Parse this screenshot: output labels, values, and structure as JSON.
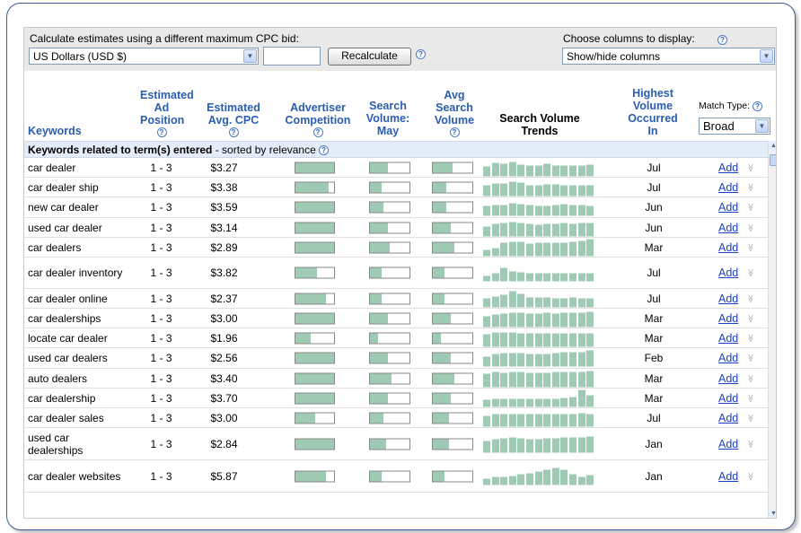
{
  "controls": {
    "cpc_label": "Calculate estimates using a different maximum CPC bid:",
    "currency_value": "US Dollars (USD $)",
    "bid_value": "",
    "recalculate_label": "Recalculate",
    "columns_label": "Choose columns to display:",
    "columns_value": "Show/hide columns",
    "match_type_label": "Match Type:",
    "match_type_value": "Broad"
  },
  "headers": {
    "keywords": "Keywords",
    "ad_position": "Estimated Ad Position",
    "avg_cpc": "Estimated Avg. CPC",
    "competition": "Advertiser Competition",
    "search_volume": "Search Volume: May",
    "avg_search_volume": "Avg Search Volume",
    "trends": "Search Volume Trends",
    "highest_volume": "Highest Volume Occurred In"
  },
  "section": {
    "title": "Keywords related to term(s) entered",
    "subtitle": " - sorted by relevance "
  },
  "add_label": "Add",
  "colors": {
    "bar_fill": "#9fcbb5",
    "header_link": "#2a5db0",
    "link": "#1a3fc4"
  },
  "rows": [
    {
      "keyword": "car dealer",
      "position": "1 - 3",
      "cpc": "$3.27",
      "competition": 1.0,
      "volume_may": 0.45,
      "avg_volume": 0.5,
      "trend": [
        0.55,
        0.75,
        0.7,
        0.8,
        0.65,
        0.6,
        0.62,
        0.7,
        0.6,
        0.62,
        0.6,
        0.62,
        0.65
      ],
      "highest": "Jul"
    },
    {
      "keyword": "car dealer ship",
      "position": "1 - 3",
      "cpc": "$3.38",
      "competition": 0.85,
      "volume_may": 0.3,
      "avg_volume": 0.35,
      "trend": [
        0.6,
        0.7,
        0.7,
        0.8,
        0.75,
        0.6,
        0.6,
        0.65,
        0.65,
        0.6,
        0.6,
        0.6,
        0.6
      ],
      "highest": "Jul"
    },
    {
      "keyword": "new car dealer",
      "position": "1 - 3",
      "cpc": "$3.59",
      "competition": 1.0,
      "volume_may": 0.35,
      "avg_volume": 0.35,
      "trend": [
        0.6,
        0.65,
        0.65,
        0.75,
        0.7,
        0.65,
        0.6,
        0.6,
        0.65,
        0.7,
        0.65,
        0.65,
        0.6
      ],
      "highest": "Jun"
    },
    {
      "keyword": "used car dealer",
      "position": "1 - 3",
      "cpc": "$3.14",
      "competition": 1.0,
      "volume_may": 0.45,
      "avg_volume": 0.45,
      "trend": [
        0.55,
        0.7,
        0.75,
        0.8,
        0.75,
        0.7,
        0.65,
        0.7,
        0.7,
        0.75,
        0.7,
        0.75,
        0.75
      ],
      "highest": "Jun"
    },
    {
      "keyword": "car dealers",
      "position": "1 - 3",
      "cpc": "$2.89",
      "competition": 1.0,
      "volume_may": 0.5,
      "avg_volume": 0.55,
      "trend": [
        0.35,
        0.45,
        0.75,
        0.8,
        0.8,
        0.7,
        0.75,
        0.75,
        0.75,
        0.75,
        0.8,
        0.85,
        1.0
      ],
      "highest": "Mar"
    },
    {
      "keyword": "car dealer inventory",
      "position": "1 - 3",
      "cpc": "$3.82",
      "competition": 0.55,
      "volume_may": 0.3,
      "avg_volume": 0.3,
      "trend": [
        0.3,
        0.5,
        0.8,
        0.6,
        0.55,
        0.5,
        0.5,
        0.5,
        0.5,
        0.5,
        0.5,
        0.5,
        0.5
      ],
      "highest": "Jul"
    },
    {
      "keyword": "car dealer online",
      "position": "1 - 3",
      "cpc": "$2.37",
      "competition": 0.8,
      "volume_may": 0.3,
      "avg_volume": 0.3,
      "trend": [
        0.5,
        0.6,
        0.7,
        0.9,
        0.75,
        0.55,
        0.55,
        0.55,
        0.5,
        0.5,
        0.55,
        0.5,
        0.5
      ],
      "highest": "Jul"
    },
    {
      "keyword": "car dealerships",
      "position": "1 - 3",
      "cpc": "$3.00",
      "competition": 1.0,
      "volume_may": 0.45,
      "avg_volume": 0.45,
      "trend": [
        0.6,
        0.7,
        0.75,
        0.8,
        0.8,
        0.75,
        0.75,
        0.8,
        0.75,
        0.8,
        0.8,
        0.8,
        0.85
      ],
      "highest": "Mar"
    },
    {
      "keyword": "locate car dealer",
      "position": "1 - 3",
      "cpc": "$1.96",
      "competition": 0.4,
      "volume_may": 0.2,
      "avg_volume": 0.2,
      "trend": [
        0.7,
        0.8,
        0.8,
        0.8,
        0.75,
        0.75,
        0.75,
        0.75,
        0.75,
        0.75,
        0.75,
        0.75,
        0.75
      ],
      "highest": "Mar"
    },
    {
      "keyword": "used car dealers",
      "position": "1 - 3",
      "cpc": "$2.56",
      "competition": 1.0,
      "volume_may": 0.45,
      "avg_volume": 0.45,
      "trend": [
        0.6,
        0.75,
        0.8,
        0.8,
        0.8,
        0.75,
        0.75,
        0.75,
        0.8,
        0.85,
        0.85,
        0.85,
        0.95
      ],
      "highest": "Feb"
    },
    {
      "keyword": "auto dealers",
      "position": "1 - 3",
      "cpc": "$3.40",
      "competition": 1.0,
      "volume_may": 0.55,
      "avg_volume": 0.55,
      "trend": [
        0.75,
        0.85,
        0.8,
        0.85,
        0.85,
        0.8,
        0.8,
        0.8,
        0.85,
        0.85,
        0.85,
        0.85,
        0.9
      ],
      "highest": "Mar"
    },
    {
      "keyword": "car dealership",
      "position": "1 - 3",
      "cpc": "$3.70",
      "competition": 1.0,
      "volume_may": 0.45,
      "avg_volume": 0.45,
      "trend": [
        0.4,
        0.45,
        0.45,
        0.45,
        0.45,
        0.45,
        0.45,
        0.45,
        0.45,
        0.5,
        0.55,
        1.0,
        0.65
      ],
      "highest": "Mar"
    },
    {
      "keyword": "car dealer sales",
      "position": "1 - 3",
      "cpc": "$3.00",
      "competition": 0.5,
      "volume_may": 0.35,
      "avg_volume": 0.4,
      "trend": [
        0.6,
        0.7,
        0.7,
        0.7,
        0.7,
        0.7,
        0.7,
        0.7,
        0.7,
        0.7,
        0.7,
        0.75,
        0.7
      ],
      "highest": "Jul"
    },
    {
      "keyword": "used car dealerships",
      "position": "1 - 3",
      "cpc": "$2.84",
      "competition": 1.0,
      "volume_may": 0.4,
      "avg_volume": 0.4,
      "trend": [
        0.65,
        0.75,
        0.8,
        0.85,
        0.8,
        0.75,
        0.75,
        0.8,
        0.8,
        0.85,
        0.85,
        0.85,
        0.9
      ],
      "highest": "Jan"
    },
    {
      "keyword": "car dealer websites",
      "position": "1 - 3",
      "cpc": "$5.87",
      "competition": 0.8,
      "volume_may": 0.3,
      "avg_volume": 0.3,
      "trend": [
        0.35,
        0.45,
        0.45,
        0.5,
        0.6,
        0.65,
        0.75,
        0.85,
        1.0,
        0.85,
        0.6,
        0.45,
        0.55
      ],
      "highest": "Jan"
    }
  ]
}
